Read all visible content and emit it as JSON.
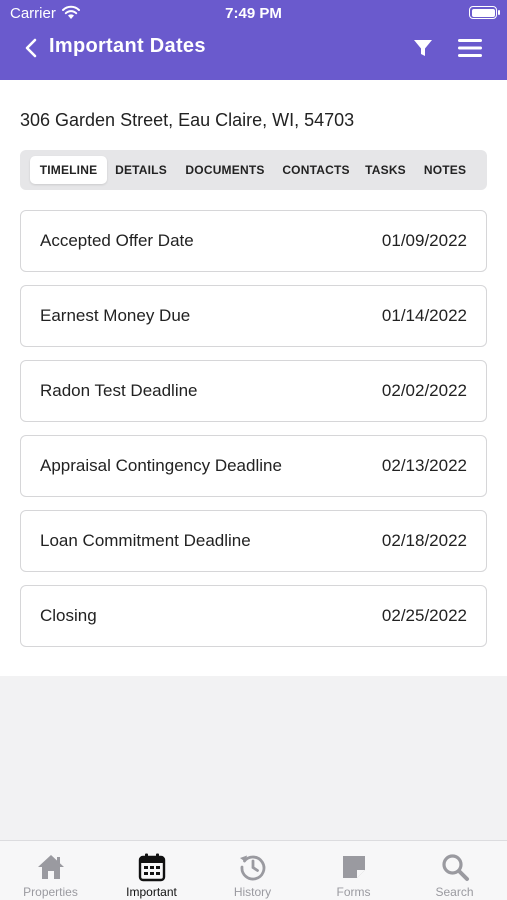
{
  "status_bar": {
    "carrier": "Carrier",
    "time": "7:49 PM"
  },
  "header": {
    "title": "Important Dates",
    "icons": [
      "back-chevron-icon",
      "filter-icon",
      "hamburger-menu-icon"
    ]
  },
  "property": {
    "address": "306 Garden Street, Eau Claire, WI, 54703"
  },
  "tabs": [
    {
      "label": "TIMELINE",
      "active": true
    },
    {
      "label": "DETAILS"
    },
    {
      "label": "DOCUMENTS"
    },
    {
      "label": "CONTACTS"
    },
    {
      "label": "TASKS"
    },
    {
      "label": "NOTES"
    }
  ],
  "timeline": [
    {
      "label": "Accepted Offer Date",
      "date": "01/09/2022"
    },
    {
      "label": "Earnest Money Due",
      "date": "01/14/2022"
    },
    {
      "label": "Radon Test Deadline",
      "date": "02/02/2022"
    },
    {
      "label": "Appraisal Contingency Deadline",
      "date": "02/13/2022"
    },
    {
      "label": "Loan Commitment Deadline",
      "date": "02/18/2022"
    },
    {
      "label": "Closing",
      "date": "02/25/2022"
    }
  ],
  "tab_bar": [
    {
      "label": "Properties",
      "icon": "home-icon"
    },
    {
      "label": "Important",
      "icon": "calendar-icon",
      "active": true
    },
    {
      "label": "History",
      "icon": "history-icon"
    },
    {
      "label": "Forms",
      "icon": "form-icon"
    },
    {
      "label": "Search",
      "icon": "search-icon"
    }
  ],
  "colors": {
    "header_bg": "#6a5acd",
    "inactive_tab_text": "#9a9aa0",
    "active_tab_text": "#111111"
  }
}
